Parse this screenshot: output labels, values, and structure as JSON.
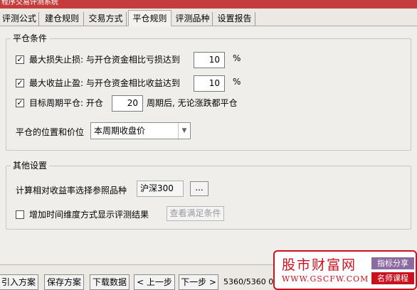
{
  "window": {
    "title": "程序交易评测系统"
  },
  "tabs": [
    {
      "label": "评测公式"
    },
    {
      "label": "建仓规则"
    },
    {
      "label": "交易方式"
    },
    {
      "label": "平仓规则",
      "active": true
    },
    {
      "label": "评测品种"
    },
    {
      "label": "设置报告"
    }
  ],
  "close_group": {
    "legend": "平仓条件",
    "stop_loss": {
      "checked": true,
      "label": "最大损失止损: 与开仓资金相比亏损达到",
      "value": "10",
      "unit": "%"
    },
    "take_profit": {
      "checked": true,
      "label": "最大收益止盈: 与开仓资金相比收益达到",
      "value": "10",
      "unit": "%"
    },
    "period_close": {
      "checked": true,
      "label": "目标周期平仓: 开仓",
      "value": "20",
      "suffix": "周期后, 无论涨跌都平仓"
    },
    "position_price": {
      "label": "平仓的位置和价位",
      "selected": "本周期收盘价"
    }
  },
  "other_group": {
    "legend": "其他设置",
    "reference": {
      "label": "计算相对收益率选择参照品种",
      "value": "沪深300",
      "browse_label": "..."
    },
    "time_dim": {
      "checked": false,
      "label": "增加时间维度方式显示评测结果",
      "button_label": "查看满足条件"
    }
  },
  "bottom": {
    "buttons": [
      {
        "label": "引入方案"
      },
      {
        "label": "保存方案"
      },
      {
        "label": "下载数据"
      },
      {
        "label": "< 上一步"
      },
      {
        "label": "下一步 >"
      }
    ],
    "status": "5360/5360 0"
  },
  "watermark": {
    "title": "股市财富网",
    "url": "WWW.GSCFW.COM",
    "tag1": "指标分享",
    "tag2": "名师课程",
    "color_brand": "#c8121e"
  }
}
